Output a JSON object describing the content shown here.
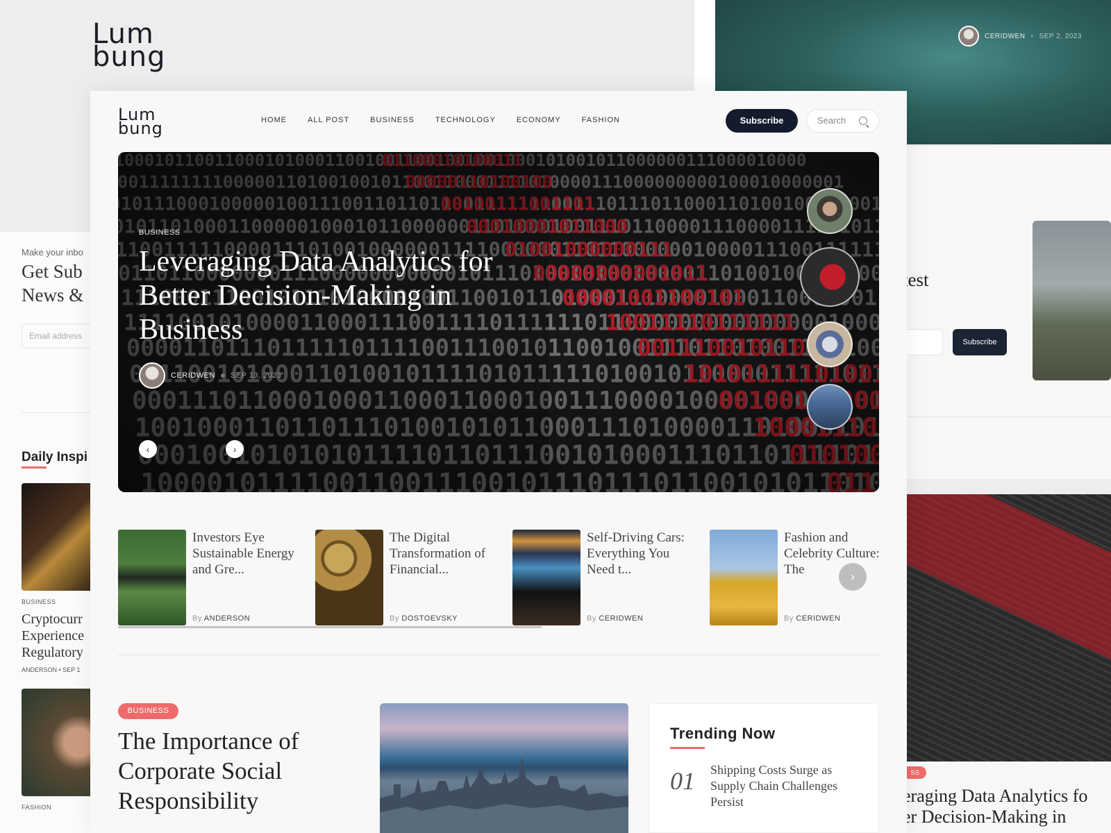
{
  "brand": {
    "logo_line1": "Lum",
    "logo_line2": "bung"
  },
  "background_cards": {
    "top_right": {
      "author": "CERIDWEN",
      "date": "SEP 2, 2023"
    },
    "right": {
      "title_fragment": "test",
      "subscribe_label": "Subscribe"
    },
    "bottom_right": {
      "tag_fragment": "SS",
      "title_line1": "eraging Data Analytics fo",
      "title_line2": "er Decision-Making in"
    },
    "left": {
      "newsletter_pre": "Make your inbo",
      "newsletter_title_line1": "Get Sub",
      "newsletter_title_line2": "News &",
      "email_placeholder": "Email address",
      "section_title": "Daily Inspi",
      "post1_category": "BUSINESS",
      "post1_title_line1": "Cryptocurr",
      "post1_title_line2": "Experience",
      "post1_title_line3": "Regulatory",
      "post1_meta": "ANDERSON  •  SEP 1",
      "post2_category": "FASHION"
    }
  },
  "nav": {
    "menu": [
      "HOME",
      "ALL POST",
      "BUSINESS",
      "TECHNOLOGY",
      "ECONOMY",
      "FASHION"
    ],
    "subscribe_label": "Subscribe",
    "search_placeholder": "Search"
  },
  "hero": {
    "category": "BUSINESS",
    "title": "Leveraging Data Analytics for Better Decision-Making in Business",
    "author": "CERIDWEN",
    "date": "SEP 13, 2023",
    "prev_icon": "‹",
    "next_icon": "›"
  },
  "slider": {
    "items": [
      {
        "title": "Investors Eye Sustainable Energy and Gre...",
        "by": "By",
        "author": "ANDERSON"
      },
      {
        "title": "The Digital Transformation of Financial...",
        "by": "By",
        "author": "DOSTOEVSKY"
      },
      {
        "title": "Self-Driving Cars: Everything You Need t...",
        "by": "By",
        "author": "CERIDWEN"
      },
      {
        "title": "Fashion and Celebrity Culture: The",
        "by": "By",
        "author": "CERIDWEN"
      }
    ],
    "next_icon": "›"
  },
  "featured": {
    "tag": "BUSINESS",
    "title": "The Importance of Corporate Social Responsibility"
  },
  "trending": {
    "heading": "Trending Now",
    "items": [
      {
        "number": "01",
        "title": "Shipping Costs Surge as Supply Chain Challenges Persist"
      }
    ]
  },
  "colors": {
    "accent": "#ef6b6b",
    "dark": "#141b2d"
  }
}
